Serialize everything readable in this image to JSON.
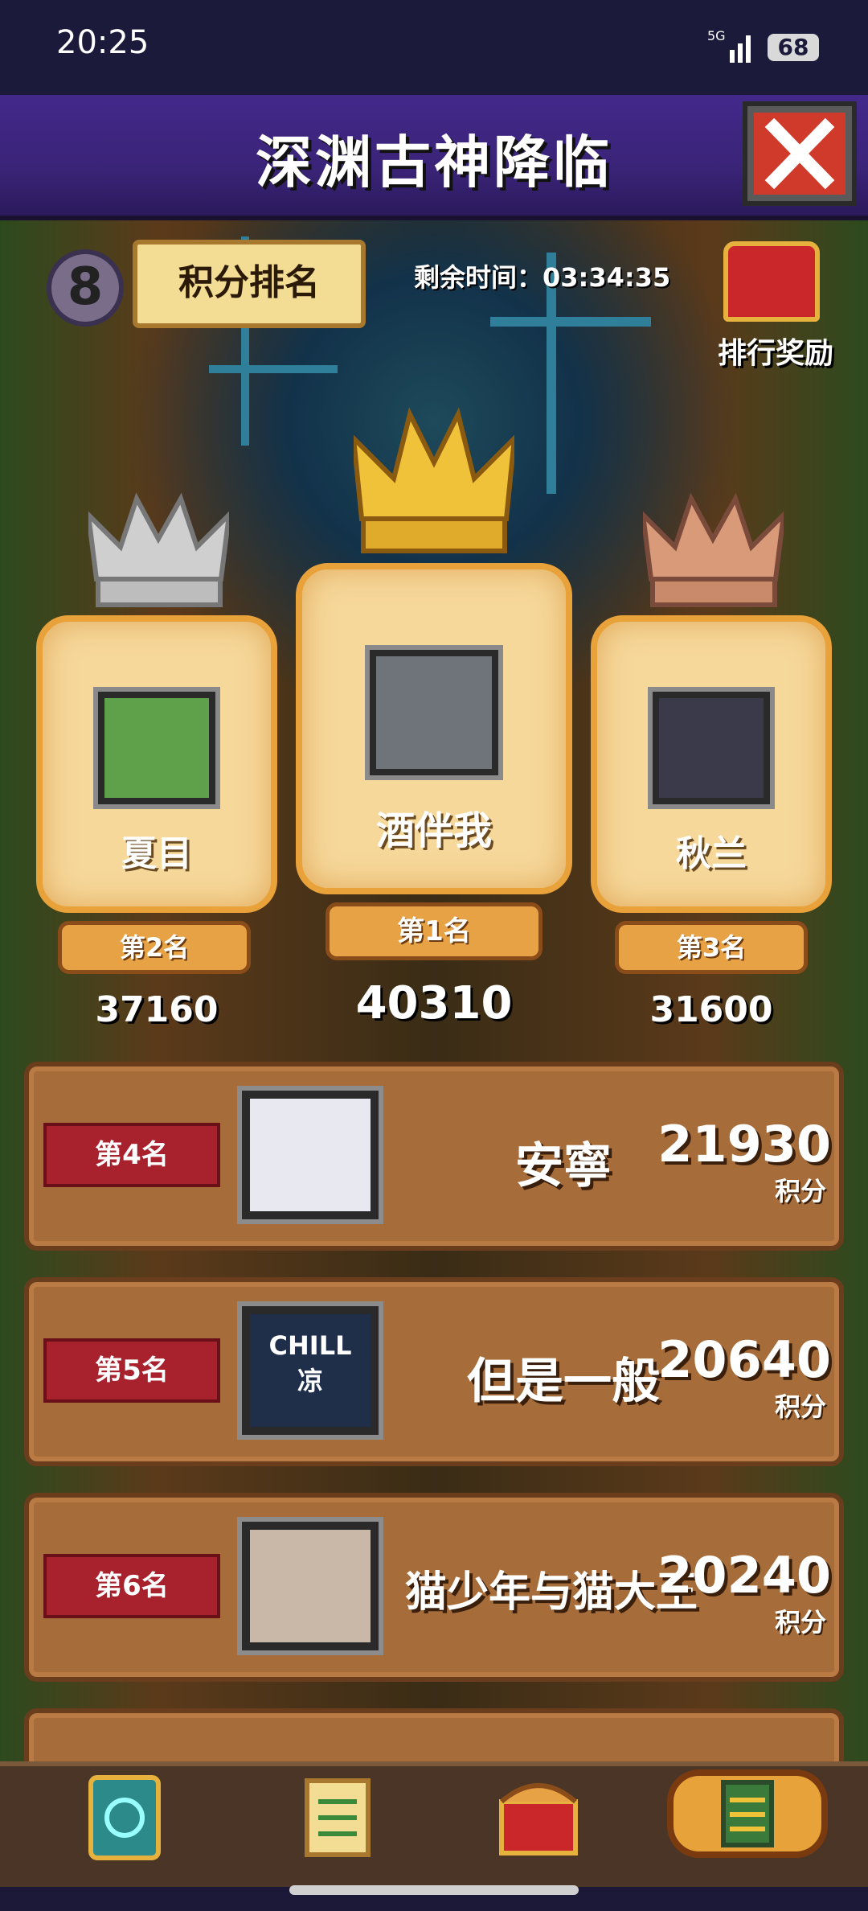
{
  "status_bar": {
    "time": "20:25",
    "network": "5G",
    "battery": "68"
  },
  "header": {
    "title": "深渊古神降临"
  },
  "top": {
    "rank_icon_text": "8",
    "ranking_label": "积分排名",
    "remaining_time_label": "剩余时间：",
    "remaining_time": "03:34:35",
    "rewards_label": "排行奖励"
  },
  "podium": [
    {
      "rank_label": "第2名",
      "name": "夏目",
      "score": "37160"
    },
    {
      "rank_label": "第1名",
      "name": "酒伴我",
      "score": "40310"
    },
    {
      "rank_label": "第3名",
      "name": "秋兰",
      "score": "31600"
    }
  ],
  "list": [
    {
      "rank_label": "第4名",
      "name": "安寧",
      "score": "21930",
      "unit": "积分"
    },
    {
      "rank_label": "第5名",
      "name": "但是一般",
      "score": "20640",
      "unit": "积分",
      "avatar_text": "CHILL\n凉"
    },
    {
      "rank_label": "第6名",
      "name": "猫少年与猫大王",
      "score": "20240",
      "unit": "积分"
    }
  ],
  "colors": {
    "gold": "#f0c23a",
    "silver": "#cfcfcf",
    "bronze": "#d99a7a",
    "rank_tag": "#a8222d"
  },
  "icons": [
    "close-icon",
    "card-icon",
    "quest-scroll-icon",
    "chest-icon",
    "leaderboard-icon"
  ]
}
